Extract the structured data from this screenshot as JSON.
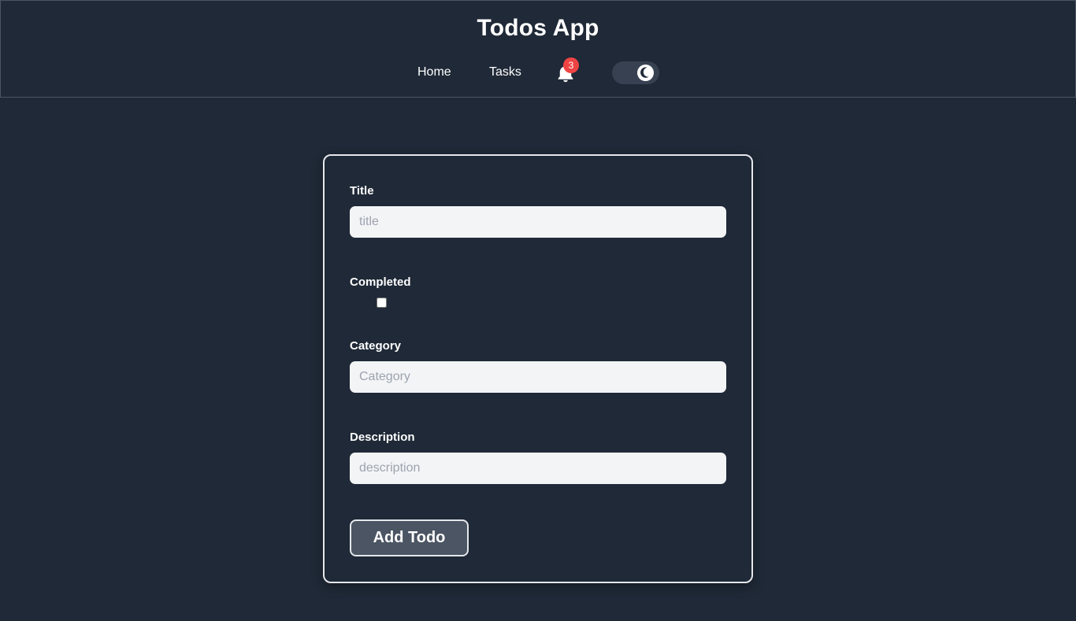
{
  "header": {
    "title": "Todos App",
    "nav": {
      "home": "Home",
      "tasks": "Tasks"
    },
    "notifications": {
      "icon": "bell-icon",
      "count": "3",
      "badge_color": "#ef4444"
    },
    "theme_toggle": {
      "icon": "moon-icon",
      "mode": "dark"
    }
  },
  "form": {
    "title": {
      "label": "Title",
      "placeholder": "title",
      "value": ""
    },
    "completed": {
      "label": "Completed",
      "checked": false
    },
    "category": {
      "label": "Category",
      "placeholder": "Category",
      "value": ""
    },
    "description": {
      "label": "Description",
      "placeholder": "description",
      "value": ""
    },
    "submit_label": "Add Todo"
  },
  "colors": {
    "background": "#1f2937",
    "input_background": "#f3f4f6",
    "button_background": "#4b5563",
    "border": "#e5e7eb"
  }
}
